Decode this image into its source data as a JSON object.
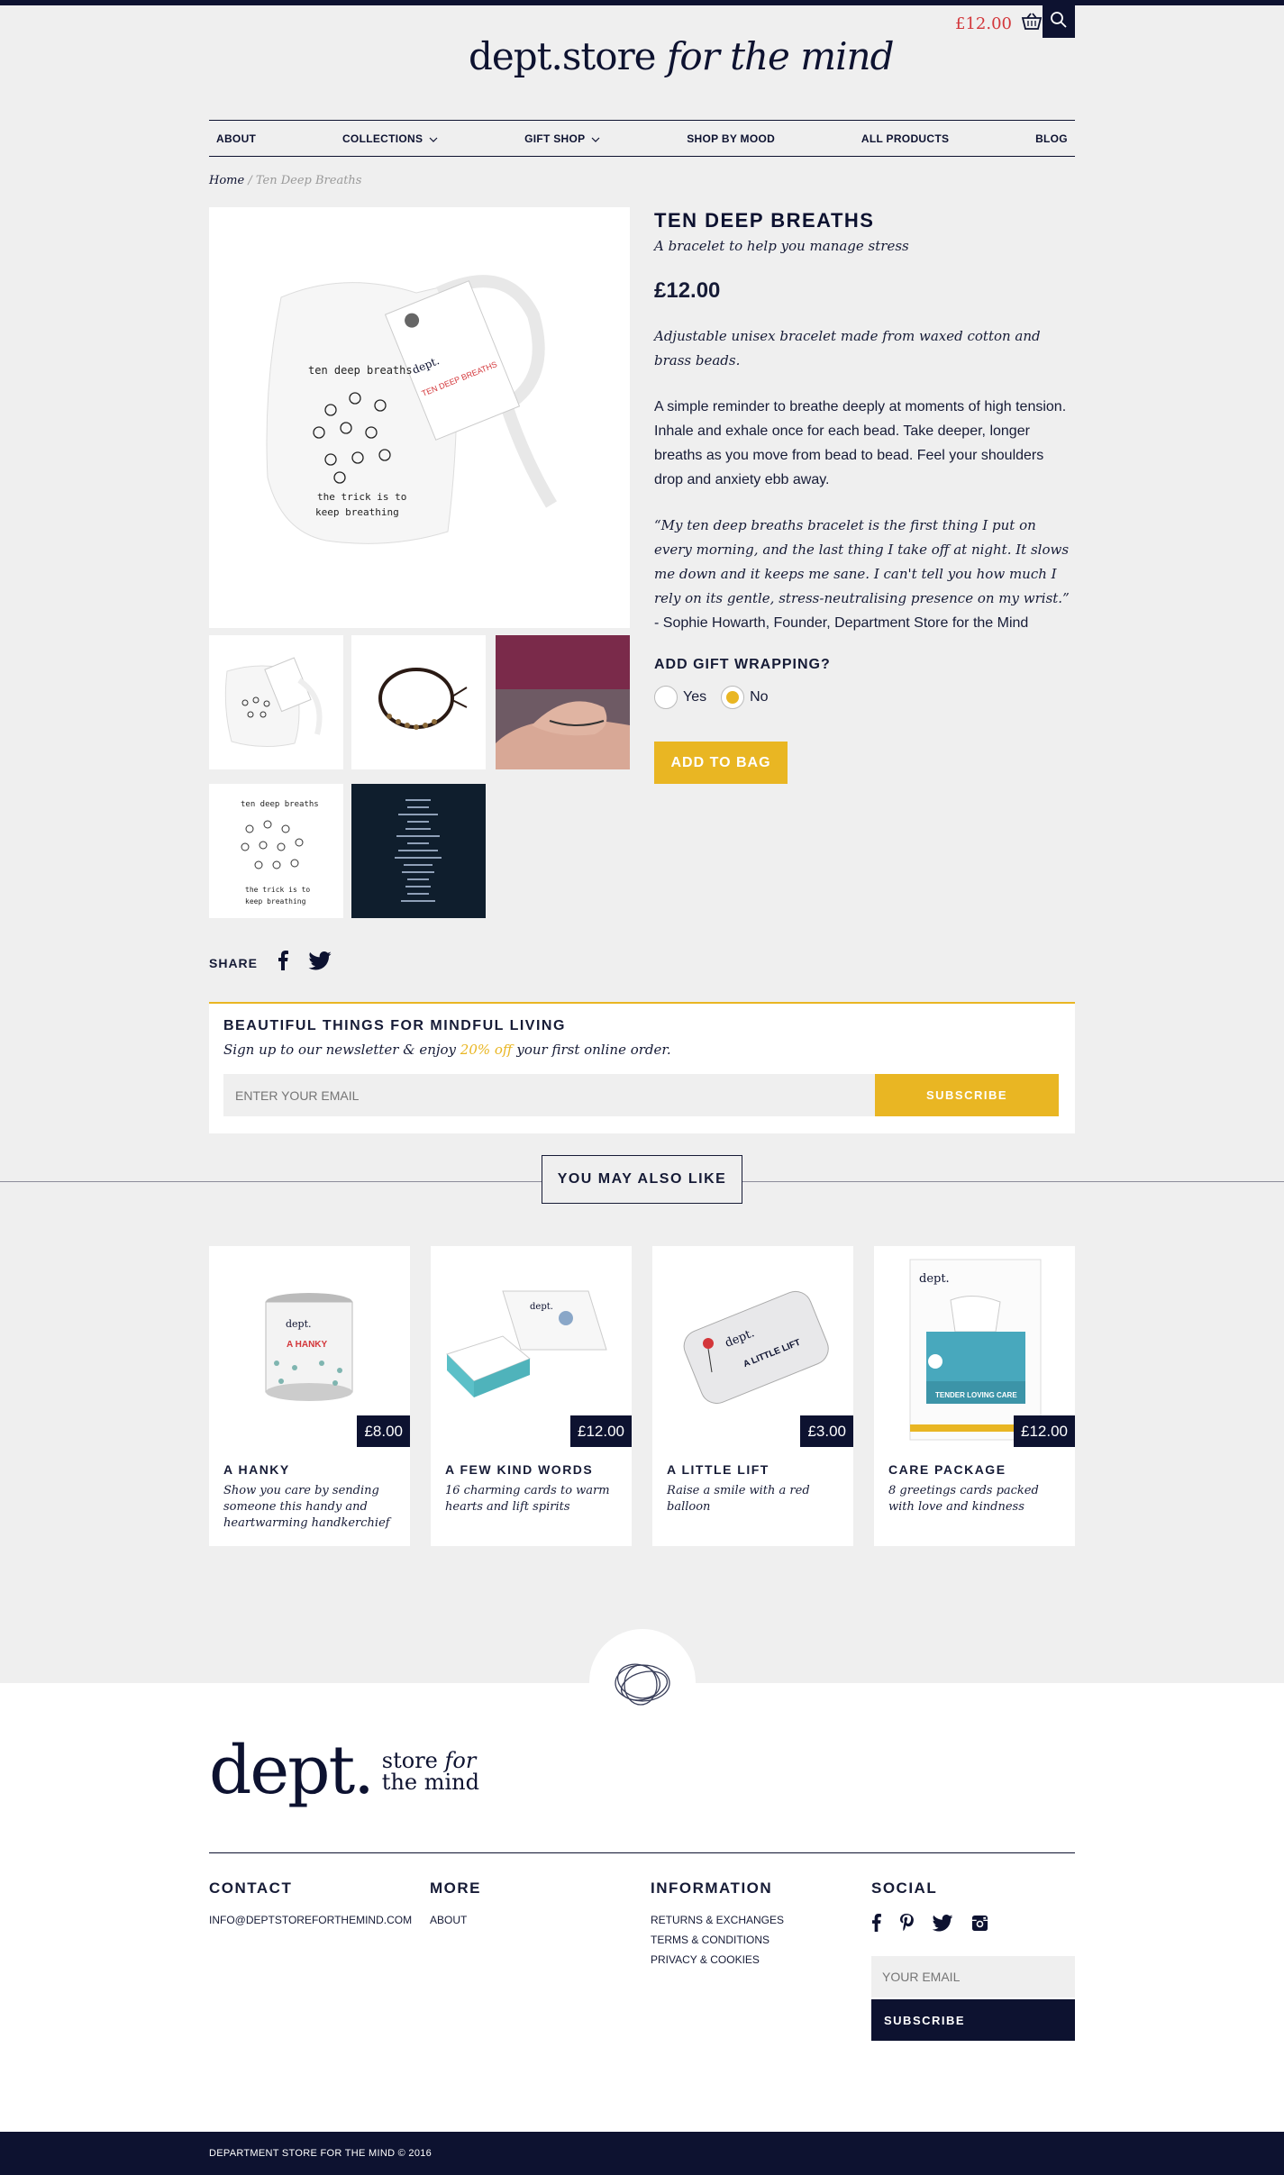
{
  "header": {
    "cart_total": "£12.00",
    "logo_main": "dept.store",
    "logo_tail": "for the mind"
  },
  "nav": {
    "items": [
      "ABOUT",
      "COLLECTIONS",
      "GIFT SHOP",
      "SHOP BY MOOD",
      "ALL PRODUCTS",
      "BLOG"
    ]
  },
  "breadcrumb": {
    "home": "Home",
    "separator": "/",
    "current": "Ten Deep Breaths"
  },
  "product": {
    "title": "TEN DEEP BREATHS",
    "subtitle": "A bracelet to help you manage stress",
    "price": "£12.00",
    "lead": "Adjustable unisex bracelet made from waxed cotton and brass beads.",
    "body": "A simple reminder to breathe deeply at moments of high tension. Inhale and exhale once for each bead. Take deeper, longer breaths as you move from bead to bead. Feel your shoulders drop and anxiety ebb away.",
    "quote": "“My ten deep breaths bracelet is the first thing I put on every morning, and the last thing I take off at night. It slows me down and it keeps me sane. I can't tell you how much I rely on its gentle, stress-neutralising presence on my wrist.”",
    "quote_attribution": "- Sophie Howarth, Founder, Department Store for the Mind",
    "gift_wrapping_label": "ADD GIFT WRAPPING?",
    "gift_options": [
      "Yes",
      "No"
    ],
    "gift_selected": "No",
    "add_to_bag": "ADD TO BAG",
    "bag_text": "ten deep breaths",
    "bag_text2": "the trick is to",
    "bag_text3": "keep breathing",
    "tag_text": "TEN DEEP BREATHS"
  },
  "share": {
    "label": "SHARE",
    "icons": [
      "facebook-icon",
      "twitter-icon"
    ]
  },
  "newsletter": {
    "title": "BEAUTIFUL THINGS FOR MINDFUL LIVING",
    "sub_before": "Sign up to our newsletter & enjoy ",
    "sub_highlight": "20% off",
    "sub_after": " your first online order.",
    "placeholder": "ENTER YOUR EMAIL",
    "button": "SUBSCRIBE"
  },
  "also_like": {
    "heading": "YOU MAY ALSO LIKE",
    "items": [
      {
        "title": "A HANKY",
        "desc": "Show you care by sending someone this handy and heartwarming handkerchief",
        "price": "£8.00",
        "label": "A HANKY"
      },
      {
        "title": "A FEW KIND WORDS",
        "desc": "16 charming cards to warm hearts and lift spirits",
        "price": "£12.00",
        "label": "dept."
      },
      {
        "title": "A LITTLE LIFT",
        "desc": "Raise a smile with a red balloon",
        "price": "£3.00",
        "label": "A LITTLE LIFT"
      },
      {
        "title": "CARE PACKAGE",
        "desc": "8 greetings cards packed with love and kindness",
        "price": "£12.00",
        "label": "TENDER LOVING CARE"
      }
    ]
  },
  "footer": {
    "logo_big": "dept.",
    "logo_small_1": "store",
    "logo_small_for": "for",
    "logo_small_2": "the mind",
    "contact": {
      "heading": "CONTACT",
      "email": "INFO@DEPTSTOREFORTHEMIND.COM"
    },
    "more": {
      "heading": "MORE",
      "links": [
        "ABOUT"
      ]
    },
    "information": {
      "heading": "INFORMATION",
      "links": [
        "RETURNS & EXCHANGES",
        "TERMS & CONDITIONS",
        "PRIVACY & COOKIES"
      ]
    },
    "social": {
      "heading": "SOCIAL",
      "icons": [
        "facebook-icon",
        "pinterest-icon",
        "twitter-icon",
        "instagram-icon"
      ],
      "placeholder": "YOUR EMAIL",
      "button": "SUBSCRIBE"
    },
    "copyright": "DEPARTMENT STORE FOR THE MIND © 2016"
  },
  "colors": {
    "navy": "#0d1230",
    "mustard": "#e9b623",
    "red": "#d3363a",
    "background": "#efefef"
  }
}
